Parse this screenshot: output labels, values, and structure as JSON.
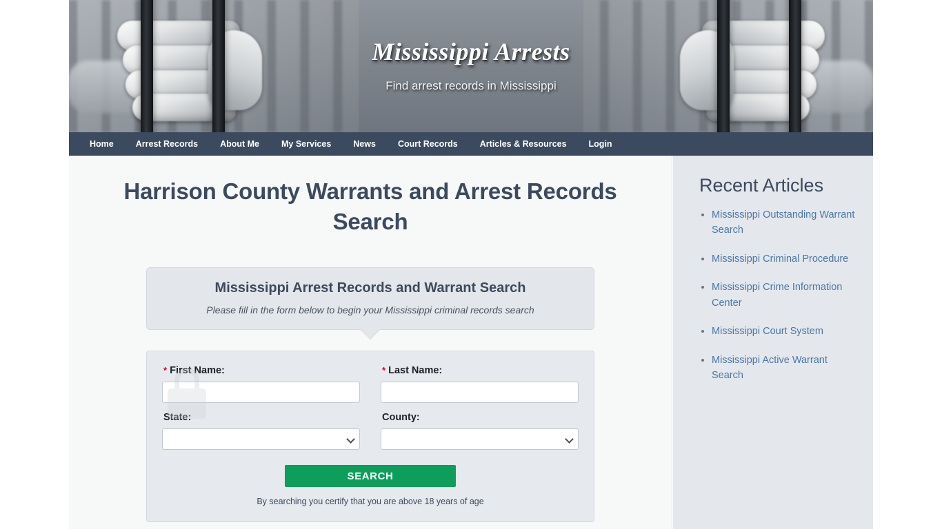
{
  "site": {
    "title": "Mississippi Arrests",
    "tagline": "Find arrest records in Mississippi"
  },
  "nav": {
    "items": [
      {
        "label": "Home"
      },
      {
        "label": "Arrest Records"
      },
      {
        "label": "About Me"
      },
      {
        "label": "My Services"
      },
      {
        "label": "News"
      },
      {
        "label": "Court Records"
      },
      {
        "label": "Articles & Resources"
      },
      {
        "label": "Login"
      }
    ]
  },
  "main": {
    "page_title": "Harrison County Warrants and Arrest Records Search",
    "callout": {
      "heading": "Mississippi Arrest Records and Warrant Search",
      "subtext": "Please fill in the form below to begin your Mississippi criminal records search"
    },
    "form": {
      "first_name": {
        "label": "First Name:",
        "required_marker": "*",
        "value": "",
        "placeholder": ""
      },
      "last_name": {
        "label": "Last Name:",
        "required_marker": "*",
        "value": "",
        "placeholder": ""
      },
      "state": {
        "label": "State:",
        "selected": "",
        "options": [
          ""
        ]
      },
      "county": {
        "label": "County:",
        "selected": "",
        "options": [
          ""
        ]
      },
      "search_button": "SEARCH",
      "disclaimer": "By searching you certify that you are above 18 years of age"
    }
  },
  "sidebar": {
    "heading": "Recent Articles",
    "articles": [
      {
        "label": "Mississippi Outstanding Warrant Search"
      },
      {
        "label": "Mississippi Criminal Procedure"
      },
      {
        "label": "Mississippi Crime Information Center"
      },
      {
        "label": "Mississippi Court System"
      },
      {
        "label": "Mississippi Active Warrant Search"
      }
    ]
  },
  "colors": {
    "nav_background": "#3b4a5e",
    "heading": "#3c4a5d",
    "link": "#4a76a8",
    "search_button": "#0d9e5b",
    "required_marker": "#d0021b",
    "sidebar_background": "#e4e7ec"
  }
}
